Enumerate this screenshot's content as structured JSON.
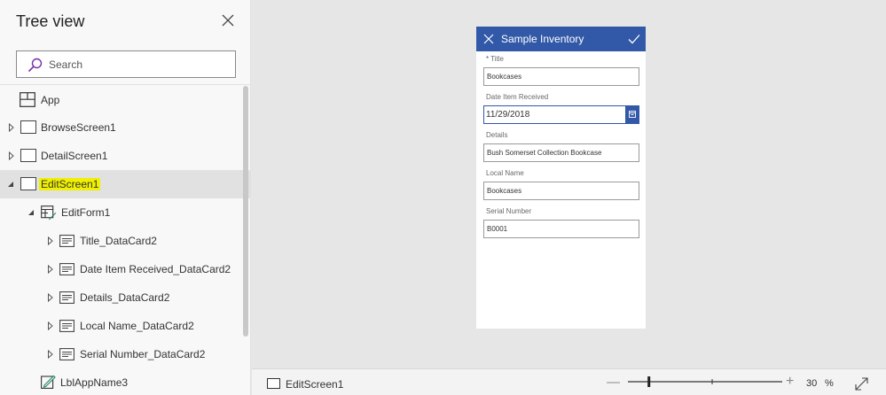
{
  "tree_view": {
    "title": "Tree view",
    "search": {
      "placeholder": "Search"
    },
    "items": [
      {
        "label": "App",
        "icon": "app-icon"
      },
      {
        "label": "BrowseScreen1",
        "icon": "screen-icon",
        "expanded": false
      },
      {
        "label": "DetailScreen1",
        "icon": "screen-icon",
        "expanded": false
      },
      {
        "label": "EditScreen1",
        "icon": "screen-icon",
        "expanded": true,
        "selected": true,
        "highlighted": true
      },
      {
        "label": "EditForm1",
        "icon": "form-icon",
        "expanded": true
      },
      {
        "label": "Title_DataCard2",
        "icon": "card-icon",
        "expanded": false
      },
      {
        "label": "Date Item Received_DataCard2",
        "icon": "card-icon",
        "expanded": false
      },
      {
        "label": "Details_DataCard2",
        "icon": "card-icon",
        "expanded": false
      },
      {
        "label": "Local Name_DataCard2",
        "icon": "card-icon",
        "expanded": false
      },
      {
        "label": "Serial Number_DataCard2",
        "icon": "card-icon",
        "expanded": false
      },
      {
        "label": "LblAppName3",
        "icon": "label-edit-icon"
      }
    ]
  },
  "phone": {
    "title": "Sample Inventory",
    "header_color": "#3258a8",
    "fields": [
      {
        "label": "Title",
        "required": true,
        "required_mark": "*",
        "value": "Bookcases"
      },
      {
        "label": "Date Item Received",
        "value": "11/29/2018",
        "icon": "calendar-icon"
      },
      {
        "label": "Details",
        "value": "Bush Somerset Collection Bookcase"
      },
      {
        "label": "Local Name",
        "value": "Bookcases"
      },
      {
        "label": "Serial Number",
        "value": "B0001"
      }
    ]
  },
  "status_bar": {
    "screen_label": "EditScreen1",
    "zoom_value": "30",
    "zoom_unit": "%",
    "zoom_level": 0.3,
    "zoom_minus": "—",
    "zoom_plus": "+"
  },
  "colors": {
    "accent": "#3258a8",
    "highlight": "#f0f000",
    "selected_row": "#e1e1e1"
  }
}
